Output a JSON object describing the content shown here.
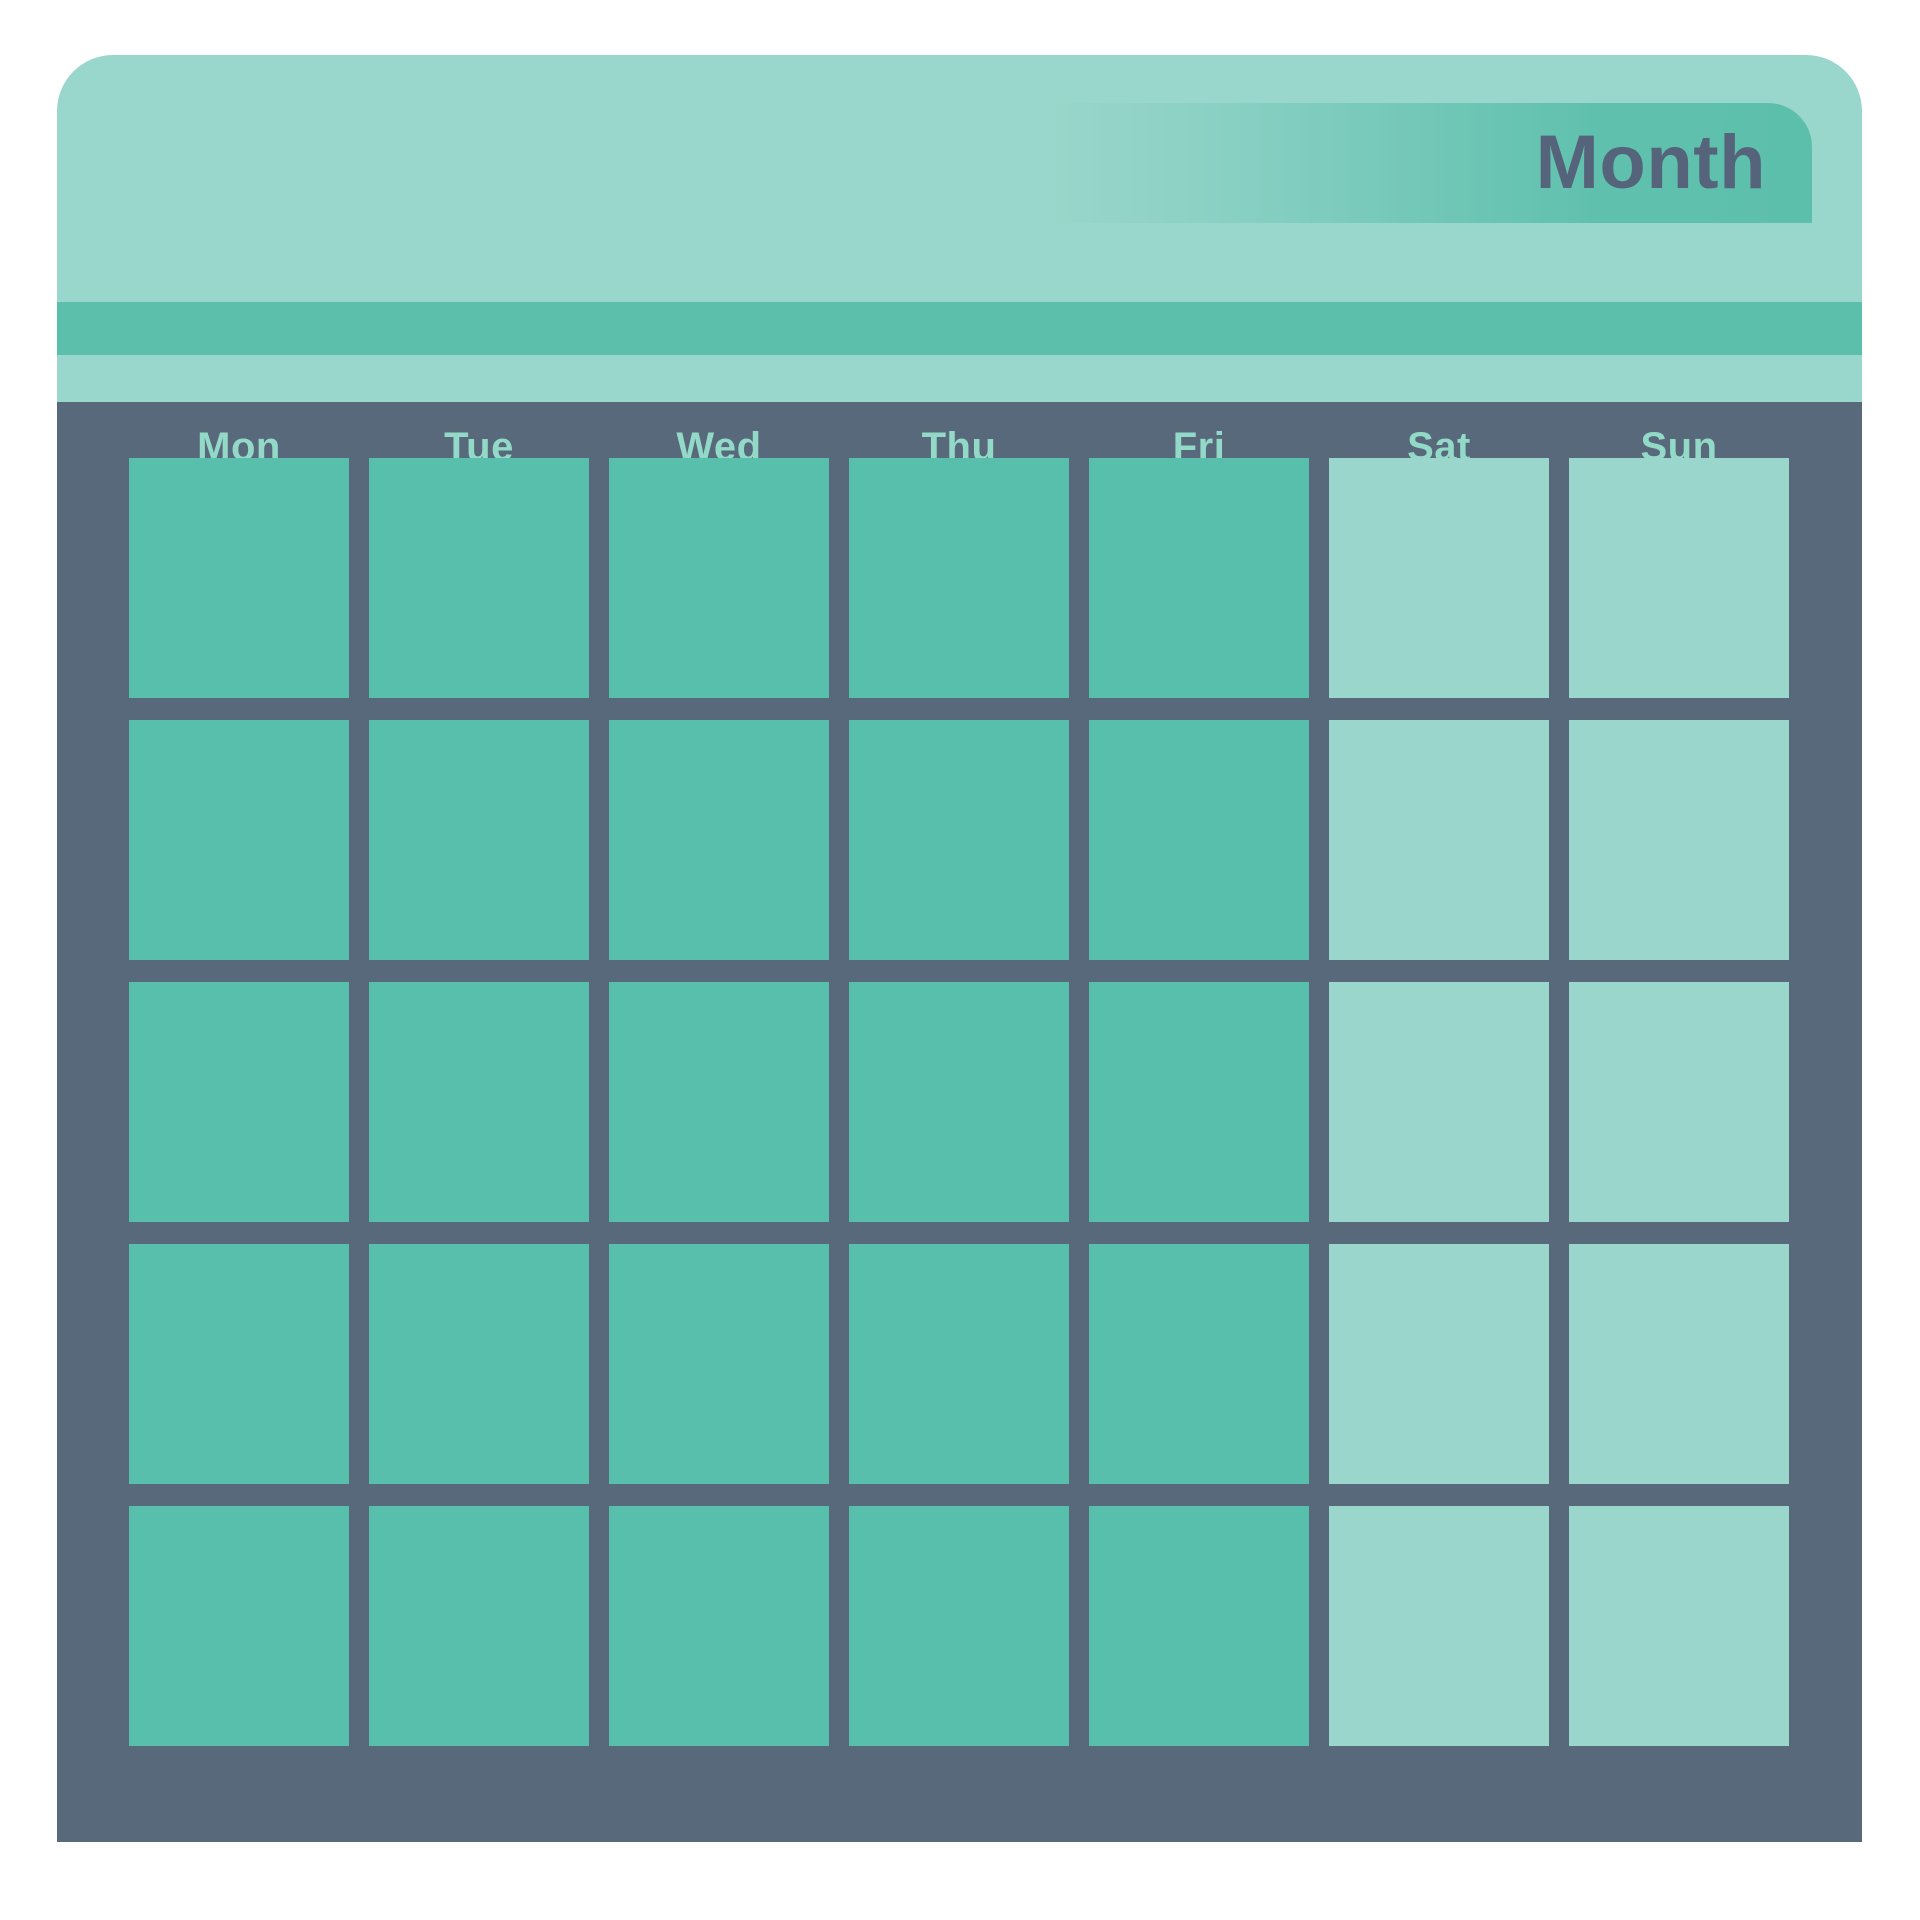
{
  "app": {
    "kind": "month-calendar-widget",
    "title": "Month"
  },
  "header": {
    "title": "Month",
    "tab_label": "Month"
  },
  "weekdays": [
    {
      "label": "Mon",
      "type": "weekday"
    },
    {
      "label": "Tue",
      "type": "weekday"
    },
    {
      "label": "Wed",
      "type": "weekday"
    },
    {
      "label": "Thu",
      "type": "weekday"
    },
    {
      "label": "Fri",
      "type": "weekday"
    },
    {
      "label": "Sat",
      "type": "weekend"
    },
    {
      "label": "Sun",
      "type": "weekend"
    }
  ],
  "grid": {
    "rows": 5,
    "columns": 7,
    "cells_total": 35,
    "weekend_columns": [
      5,
      6
    ],
    "cell_labels": [
      [
        "",
        "",
        "",
        "",
        "",
        "",
        ""
      ],
      [
        "",
        "",
        "",
        "",
        "",
        "",
        ""
      ],
      [
        "",
        "",
        "",
        "",
        "",
        "",
        ""
      ],
      [
        "",
        "",
        "",
        "",
        "",
        "",
        ""
      ],
      [
        "",
        "",
        "",
        "",
        "",
        "",
        ""
      ]
    ]
  },
  "colors": {
    "header_mint": "#99d6cb",
    "accent_teal": "#5cbfac",
    "body_slate": "#58697b",
    "weekday_cell": "#57bfac",
    "weekend_cell": "#9ad6cb",
    "title_text": "#55647a",
    "weekday_label_text": "#92d9c8",
    "page_background": "#ffffff"
  }
}
